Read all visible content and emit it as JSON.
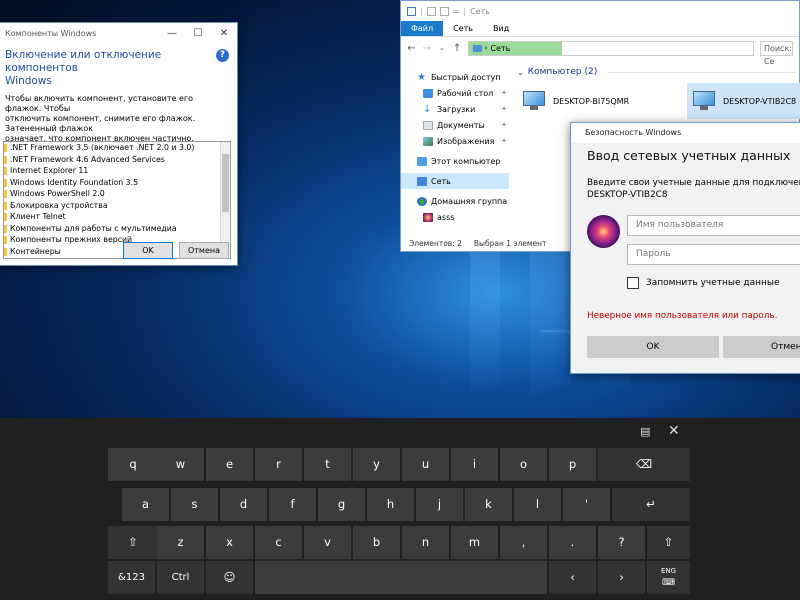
{
  "features_dialog": {
    "title": "Компоненты Windows",
    "heading_line1": "Включение или отключение компонентов",
    "heading_line2": "Windows",
    "description_line1": "Чтобы включить компонент, установите его флажок. Чтобы",
    "description_line2": "отключить компонент, снимите его флажок. Затененный флажок",
    "description_line3": "означает, что компонент включен частично.",
    "items": [
      ".NET Framework 3.5 (включает .NET 2.0 и 3.0)",
      ".NET Framework 4.6 Advanced Services",
      "Internet Explorer 11",
      "Windows Identity Foundation 3.5",
      "Windows PowerShell 2.0",
      "Блокировка устройства",
      "Клиент Telnet",
      "Компоненты для работы с мультимедиа",
      "Компоненты прежних версий",
      "Контейнеры"
    ],
    "ok_label": "OK",
    "cancel_label": "Отмена"
  },
  "explorer": {
    "title": "Сеть",
    "ribbon_tabs": [
      "Файл",
      "Сеть",
      "Вид"
    ],
    "address": "Сеть",
    "search_placeholder": "Поиск: Се",
    "address_progress": 0.33,
    "nav": {
      "quick_access": "Быстрый доступ",
      "desktop": "Рабочий стол",
      "downloads": "Загрузки",
      "documents": "Документы",
      "pictures": "Изображения",
      "this_pc": "Этот компьютер",
      "network": "Сеть",
      "homegroup": "Домашняя группа",
      "user": "asss"
    },
    "group_header": "Компьютер (2)",
    "computers": [
      "DESKTOP-BI75QMR",
      "DESKTOP-VTIB2C8"
    ],
    "status_items": "Элементов: 2",
    "status_selected": "Выбран 1 элемент"
  },
  "credentials_dialog": {
    "title": "Безопасность Windows",
    "heading": "Ввод сетевых учетных данных",
    "description_line1": "Введите свои учетные данные для подключения к:",
    "description_line2": "DESKTOP-VTIB2C8",
    "username_placeholder": "Имя пользователя",
    "password_placeholder": "Пароль",
    "remember_label": "Запомнить учетные данные",
    "error_text": "Неверное имя пользователя или пароль.",
    "ok_label": "OK",
    "cancel_label": "Отмена"
  },
  "keyboard": {
    "row1": [
      "q",
      "w",
      "e",
      "r",
      "t",
      "y",
      "u",
      "i",
      "o",
      "p"
    ],
    "row2": [
      "a",
      "s",
      "d",
      "f",
      "g",
      "h",
      "j",
      "k",
      "l",
      "'"
    ],
    "row3": [
      "z",
      "x",
      "c",
      "v",
      "b",
      "n",
      "m",
      ",",
      ".",
      "?"
    ],
    "sym_label": "&123",
    "ctrl_label": "Ctrl",
    "lang_label": "ENG",
    "backspace_icon": "backspace-icon",
    "enter_icon": "enter-icon",
    "shift_icon": "shift-icon",
    "emoji_icon": "emoji-icon"
  }
}
